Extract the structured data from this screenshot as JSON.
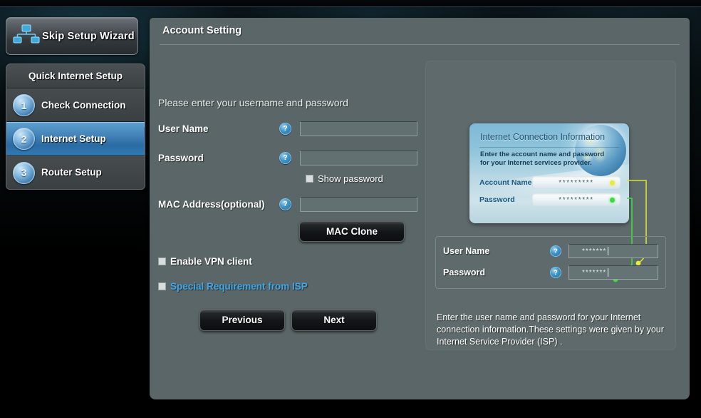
{
  "sidebar": {
    "skip_button_label": "Skip Setup Wizard",
    "skip_button_icon": "network-tree-icon",
    "section_title": "Quick Internet Setup",
    "steps": [
      {
        "number": "1",
        "label": "Check Connection",
        "active": false
      },
      {
        "number": "2",
        "label": "Internet Setup",
        "active": true
      },
      {
        "number": "3",
        "label": "Router Setup",
        "active": false
      }
    ]
  },
  "main": {
    "panel_title": "Account Setting",
    "intro": "Please enter your username and password",
    "fields": [
      {
        "label": "User Name",
        "value": "",
        "help_icon": "question-mark-icon"
      },
      {
        "label": "Password",
        "value": "",
        "help_icon": "question-mark-icon"
      }
    ],
    "show_password": {
      "label": "Show password",
      "checked": false
    },
    "mac_address": {
      "label": "MAC Address(optional)",
      "value": "",
      "help_icon": "question-mark-icon"
    },
    "mac_clone_button": "MAC Clone",
    "options": [
      {
        "label": "Enable VPN client",
        "checked": false,
        "is_link": false
      },
      {
        "label": "Special Requirement from ISP",
        "checked": false,
        "is_link": true
      }
    ],
    "nav": {
      "previous": "Previous",
      "next": "Next"
    }
  },
  "help": {
    "illustration": {
      "title": "Internet Connection Information",
      "description": "Enter the account name and password for your Internet services provider.",
      "globe_icon": "globe-icon",
      "rows": [
        {
          "label": "Account Name",
          "value": "*********",
          "marker_color": "#e8ea3e"
        },
        {
          "label": "Password",
          "value": "*********",
          "marker_color": "#3ddc3d"
        }
      ]
    },
    "mini_form": [
      {
        "label": "User Name",
        "value": "*******",
        "help_icon": "question-mark-icon"
      },
      {
        "label": "Password",
        "value": "*******",
        "help_icon": "question-mark-icon"
      }
    ],
    "text": "Enter the user name and password for your Internet connection information.These settings were given by your Internet Service Provider (ISP) ."
  },
  "colors": {
    "accent_blue": "#3ea7e8",
    "panel_bg": "#5b6668",
    "help_bg": "#5f6a6c",
    "marker_yellow": "#e8ea3e",
    "marker_green": "#3ddc3d"
  }
}
